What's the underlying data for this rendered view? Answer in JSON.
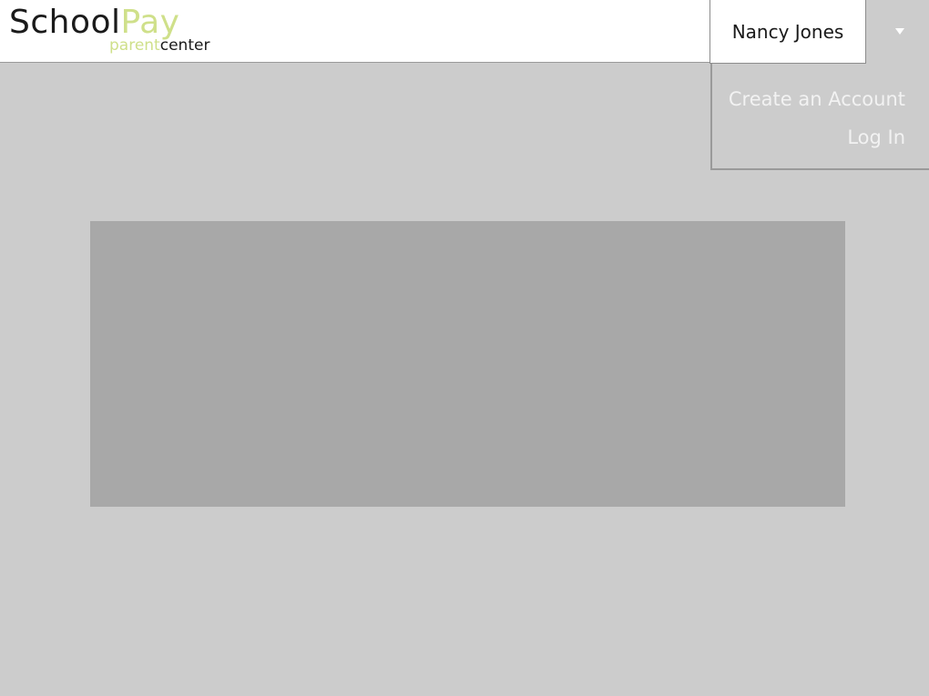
{
  "brand": {
    "school": "School",
    "pay": "Pay",
    "parent": "parent",
    "center": "center"
  },
  "user": {
    "name": "Nancy Jones"
  },
  "menu": {
    "items": [
      {
        "label": "Create an Account"
      },
      {
        "label": "Log In"
      }
    ]
  },
  "colors": {
    "header_bg": "#ffffff",
    "page_bg": "#cccccc",
    "panel_bg": "#a8a8a8",
    "brand_accent": "#cfe08a",
    "menu_text": "#f2f2f2"
  },
  "icons": {
    "dropdown": "chevron-down-icon"
  }
}
